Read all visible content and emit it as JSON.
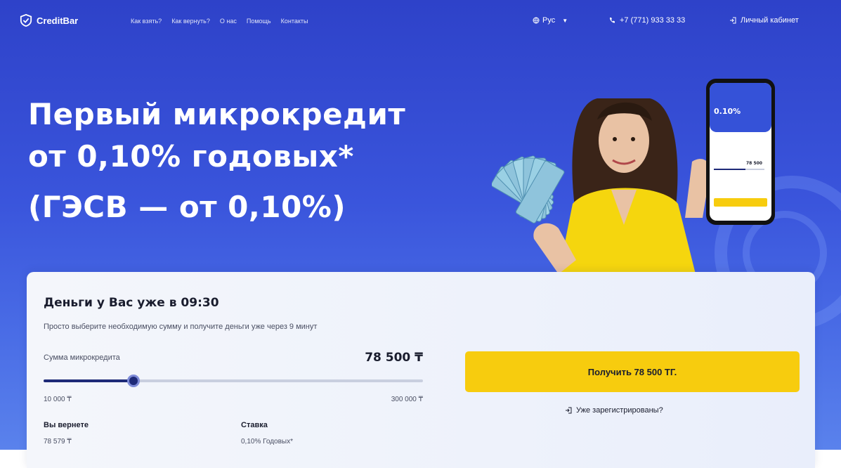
{
  "header": {
    "logo_text": "CreditBar",
    "nav": [
      {
        "label": "Как взять?"
      },
      {
        "label": "Как вернуть?"
      },
      {
        "label": "О нас"
      },
      {
        "label": "Помощь"
      },
      {
        "label": "Контакты"
      }
    ],
    "language": "Рус",
    "phone": "+7 (771) 933 33 33",
    "cabinet": "Личный кабинет"
  },
  "hero": {
    "lines": [
      "Первый микрокредит",
      "от 0,10% годовых*",
      "(ГЭСВ — от 0,10%)"
    ]
  },
  "phone_mockup": {
    "rate": "0.10%",
    "amount": "78 500"
  },
  "form": {
    "title": "Деньги у Вас уже в 09:30",
    "subtitle": "Просто выберите необходимую сумму и получите деньги уже через 9 минут",
    "amount_label": "Сумма микрокредита",
    "amount_value": "78 500 ₸",
    "slider": {
      "min": 10000,
      "max": 300000,
      "value": 78500
    },
    "min_label": "10 000 ₸",
    "max_label": "300 000 ₸",
    "return_label": "Вы вернете",
    "return_value": "78 579 ₸",
    "rate_label": "Ставка",
    "rate_value": "0,10% Годовых*",
    "submit_label": "Получить 78 500 ТГ.",
    "registered_label": "Уже зарегистрированы?"
  },
  "colors": {
    "hero_blue": "#3a55dc",
    "accent_yellow": "#f7cc0e",
    "slider_dark": "#1e2a78"
  }
}
